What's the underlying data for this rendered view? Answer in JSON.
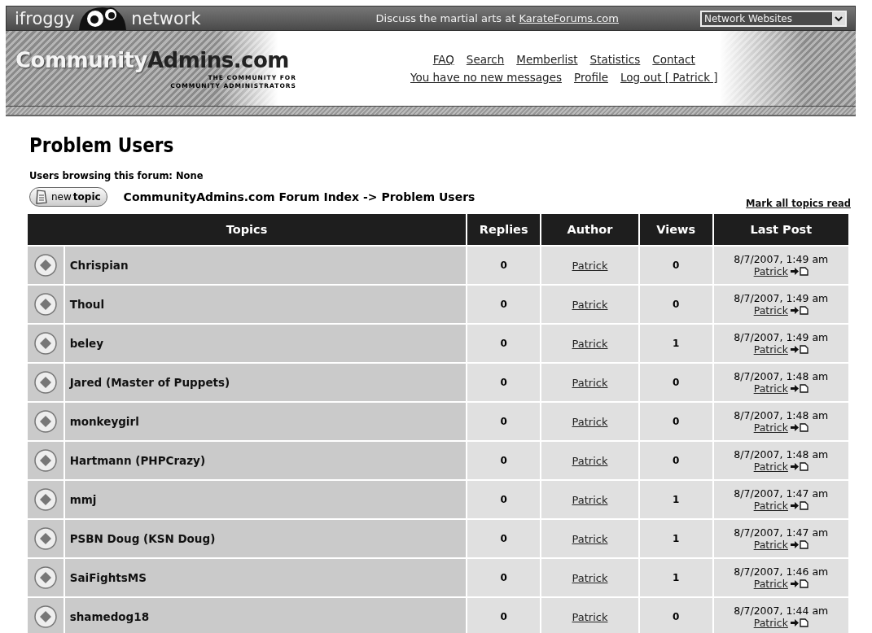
{
  "network_bar": {
    "brand_left": "ifroggy",
    "brand_right": "network",
    "promo": "Discuss the martial arts at ",
    "promo_link": "KarateForums.com",
    "select": "Network Websites"
  },
  "header": {
    "logo_light": "Community",
    "logo_dark": "Admins.com",
    "tagline_1": "THE COMMUNITY FOR",
    "tagline_2": "COMMUNITY ADMINISTRATORS",
    "nav_1": [
      "FAQ",
      "Search",
      "Memberlist",
      "Statistics",
      "Contact"
    ],
    "nav_2": [
      "You have no new messages",
      "Profile",
      "Log out [ Patrick ]"
    ]
  },
  "title": "Problem Users",
  "browsing": "Users browsing this forum: None",
  "new_topic_button": {
    "light": "new",
    "bold": "topic"
  },
  "breadcrumb": "CommunityAdmins.com Forum Index -> Problem Users",
  "mark_read": "Mark all topics read",
  "table": {
    "columns": [
      "Topics",
      "Replies",
      "Author",
      "Views",
      "Last Post"
    ],
    "rows": [
      {
        "topic": "Chrispian",
        "replies": "0",
        "author": "Patrick",
        "views": "0",
        "last_date": "8/7/2007, 1:49 am",
        "last_user": "Patrick"
      },
      {
        "topic": "Thoul",
        "replies": "0",
        "author": "Patrick",
        "views": "0",
        "last_date": "8/7/2007, 1:49 am",
        "last_user": "Patrick"
      },
      {
        "topic": "beley",
        "replies": "0",
        "author": "Patrick",
        "views": "1",
        "last_date": "8/7/2007, 1:49 am",
        "last_user": "Patrick"
      },
      {
        "topic": "Jared (Master of Puppets)",
        "replies": "0",
        "author": "Patrick",
        "views": "0",
        "last_date": "8/7/2007, 1:48 am",
        "last_user": "Patrick"
      },
      {
        "topic": "monkeygirl",
        "replies": "0",
        "author": "Patrick",
        "views": "0",
        "last_date": "8/7/2007, 1:48 am",
        "last_user": "Patrick"
      },
      {
        "topic": "Hartmann (PHPCrazy)",
        "replies": "0",
        "author": "Patrick",
        "views": "0",
        "last_date": "8/7/2007, 1:48 am",
        "last_user": "Patrick"
      },
      {
        "topic": "mmj",
        "replies": "0",
        "author": "Patrick",
        "views": "1",
        "last_date": "8/7/2007, 1:47 am",
        "last_user": "Patrick"
      },
      {
        "topic": "PSBN Doug (KSN Doug)",
        "replies": "0",
        "author": "Patrick",
        "views": "1",
        "last_date": "8/7/2007, 1:47 am",
        "last_user": "Patrick"
      },
      {
        "topic": "SaiFightsMS",
        "replies": "0",
        "author": "Patrick",
        "views": "1",
        "last_date": "8/7/2007, 1:46 am",
        "last_user": "Patrick"
      },
      {
        "topic": "shamedog18",
        "replies": "0",
        "author": "Patrick",
        "views": "0",
        "last_date": "8/7/2007, 1:44 am",
        "last_user": "Patrick"
      }
    ]
  }
}
